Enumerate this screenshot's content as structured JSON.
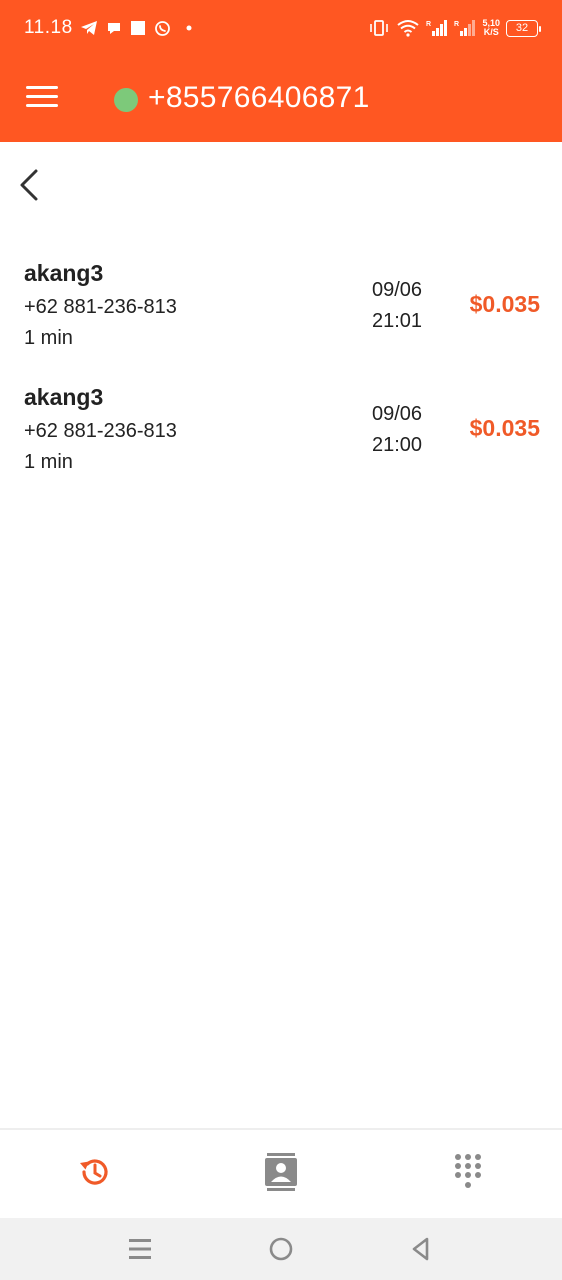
{
  "status_bar": {
    "time": "11.18",
    "net_speed_value": "5,10",
    "net_speed_unit": "K/S",
    "battery": "32",
    "left_icons": [
      "telegram-icon",
      "chat-bubble-icon",
      "square-notification-icon",
      "whatsapp-icon",
      "dot-icon"
    ],
    "right_icons": [
      "vibrate-icon",
      "wifi-icon",
      "signal-icon",
      "signal-icon"
    ]
  },
  "app_bar": {
    "title": "+855766406871",
    "status_color": "#7dc97a",
    "brand_color": "#ff5722"
  },
  "calls": [
    {
      "name": "akang3",
      "number": "+62 881-236-813",
      "duration": "1 min",
      "date": "09/06",
      "time": "21:01",
      "cost": "$0.035"
    },
    {
      "name": "akang3",
      "number": "+62 881-236-813",
      "duration": "1 min",
      "date": "09/06",
      "time": "21:00",
      "cost": "$0.035"
    }
  ],
  "bottom_nav": {
    "items": [
      "history-icon",
      "contacts-icon",
      "dialpad-icon"
    ],
    "active": "history-icon",
    "active_color": "#f05a28",
    "inactive_color": "#8a8a8a"
  },
  "system_nav": [
    "recents-icon",
    "home-icon",
    "back-icon"
  ]
}
